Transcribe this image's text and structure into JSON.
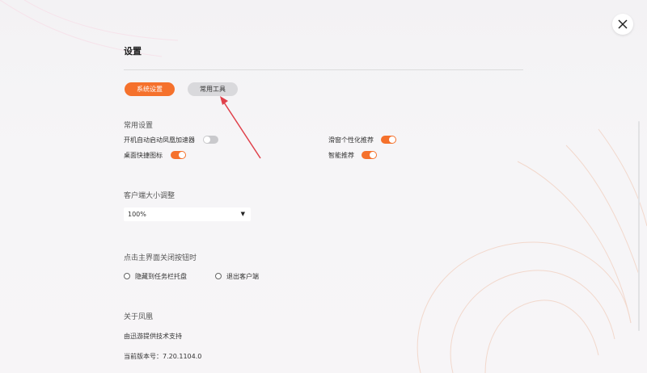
{
  "page": {
    "title": "设置"
  },
  "tabs": [
    {
      "label": "系统设置",
      "active": true
    },
    {
      "label": "常用工具",
      "active": false
    }
  ],
  "sections": {
    "common": {
      "title": "常用设置",
      "options": [
        {
          "label": "开机自动启动凤凰加速器",
          "enabled": false
        },
        {
          "label": "滑窗个性化推荐",
          "enabled": true
        },
        {
          "label": "桌面快捷图标",
          "enabled": true
        },
        {
          "label": "智能推荐",
          "enabled": true
        }
      ]
    },
    "size": {
      "title": "客户端大小调整",
      "value": "100%"
    },
    "close_behavior": {
      "title": "点击主界面关闭按钮时",
      "options": [
        {
          "label": "隐藏到任务栏托盘",
          "selected": false
        },
        {
          "label": "退出客户端",
          "selected": false
        }
      ]
    },
    "about": {
      "title": "关于凤凰",
      "support": "由迅游提供技术支持",
      "version": "当前版本号：7.20.1104.0"
    }
  },
  "colors": {
    "accent": "#f5712c",
    "annotation_arrow": "#e0404a"
  },
  "icons": {
    "close": "close-icon",
    "dropdown": "caret-down-icon",
    "annotation": "arrow-annotation-icon"
  }
}
